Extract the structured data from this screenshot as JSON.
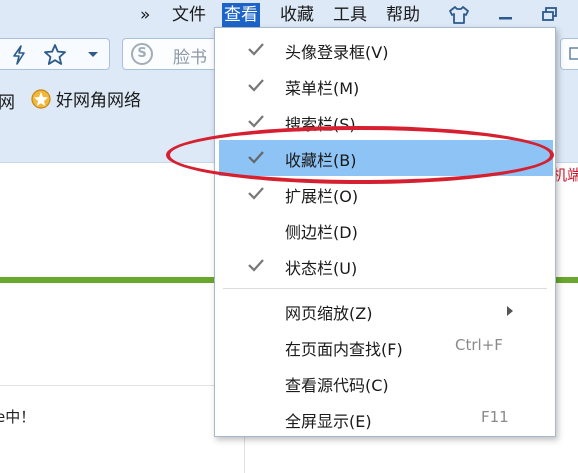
{
  "menubar": {
    "more": "»",
    "items": [
      "文件",
      "查看",
      "收藏",
      "工具",
      "帮助"
    ],
    "active": "查看"
  },
  "search": {
    "placeholder": "脸书"
  },
  "bookmarks": {
    "partial": "网",
    "item": "好网角网络"
  },
  "content": {
    "right_text": "机端",
    "partial": "e中！"
  },
  "view_menu": {
    "items": [
      {
        "label": "头像登录框(V)",
        "checked": true
      },
      {
        "label": "菜单栏(M)",
        "checked": true
      },
      {
        "label": "搜索栏(S)",
        "checked": true
      },
      {
        "label": "收藏栏(B)",
        "checked": true,
        "highlighted": true
      },
      {
        "label": "扩展栏(O)",
        "checked": true
      },
      {
        "label": "侧边栏(D)",
        "checked": false
      },
      {
        "label": "状态栏(U)",
        "checked": true
      },
      {
        "label": "网页缩放(Z)",
        "submenu": true
      },
      {
        "label": "在页面内查找(F)",
        "shortcut": "Ctrl+F"
      },
      {
        "label": "查看源代码(C)"
      },
      {
        "label": "全屏显示(E)",
        "shortcut": "F11"
      }
    ]
  },
  "colors": {
    "highlight": "#8ec3f5",
    "menu_active": "#1d64c8",
    "annotation": "#d6202f",
    "accent_line": "#6aa72d"
  }
}
